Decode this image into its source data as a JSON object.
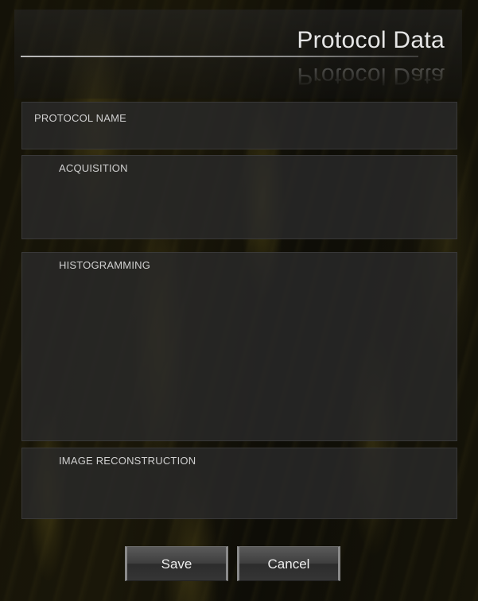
{
  "header": {
    "title": "Protocol Data"
  },
  "sections": {
    "protocol_name": "PROTOCOL NAME",
    "acquisition": "ACQUISITION",
    "histogramming": "HISTOGRAMMING",
    "image_reconstruction": "IMAGE RECONSTRUCTION"
  },
  "buttons": {
    "save": "Save",
    "cancel": "Cancel"
  },
  "colors": {
    "accent_gold": "#9a8530",
    "panel": "#2a2a2a",
    "text": "#d0d0d0"
  }
}
